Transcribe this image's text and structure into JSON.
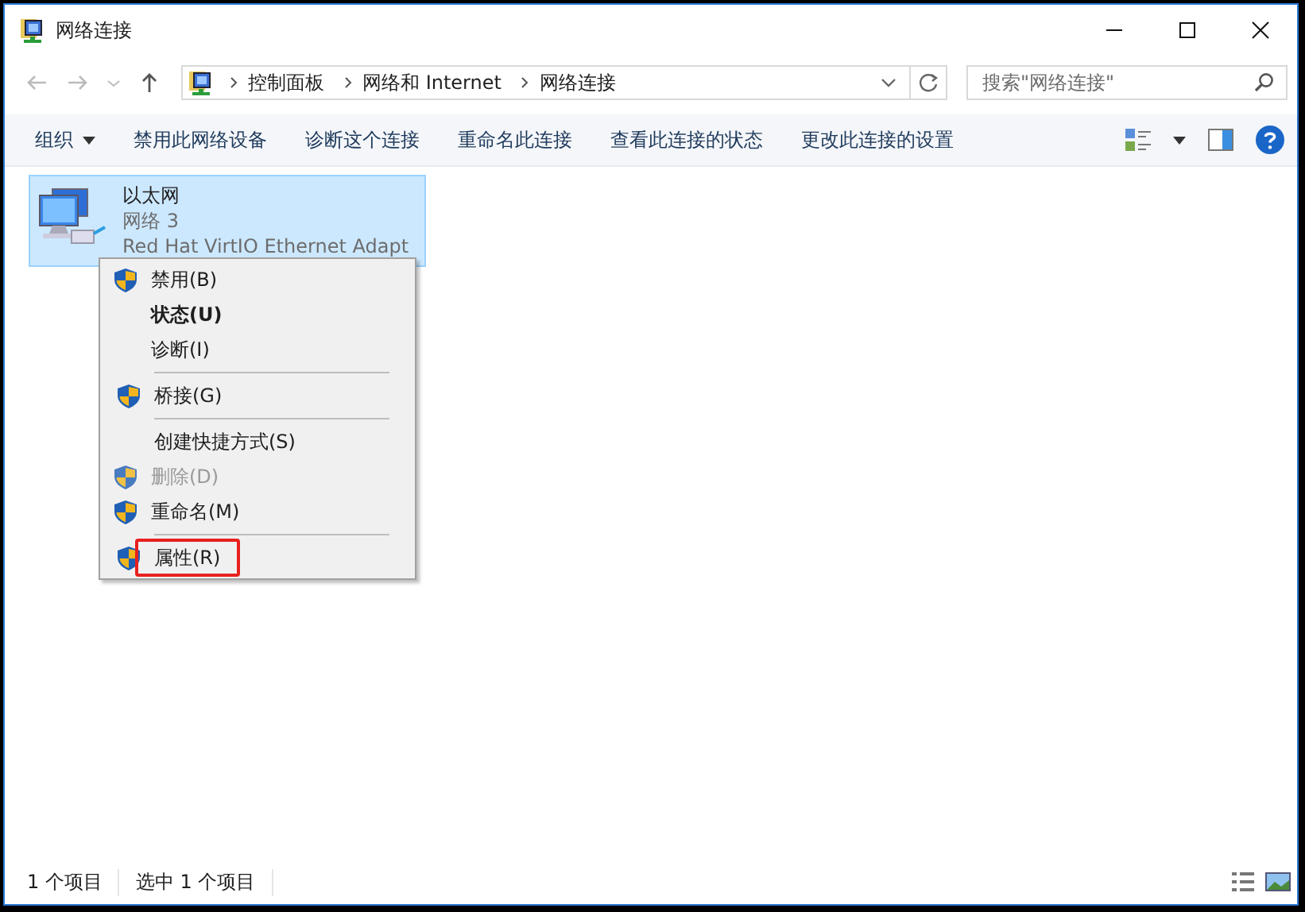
{
  "window": {
    "title": "网络连接"
  },
  "nav": {
    "crumbs": [
      "控制面板",
      "网络和 Internet",
      "网络连接"
    ],
    "search": {
      "placeholder": "搜索\"网络连接\""
    }
  },
  "toolbar": {
    "items": [
      {
        "label": "组织",
        "dropdown": true
      },
      {
        "label": "禁用此网络设备",
        "dropdown": false
      },
      {
        "label": "诊断这个连接",
        "dropdown": false
      },
      {
        "label": "重命名此连接",
        "dropdown": false
      },
      {
        "label": "查看此连接的状态",
        "dropdown": false
      },
      {
        "label": "更改此连接的设置",
        "dropdown": false
      }
    ]
  },
  "connections": [
    {
      "title": "以太网",
      "network": "网络  3",
      "adapter": "Red Hat VirtIO Ethernet Adapt",
      "selected": true
    }
  ],
  "context_menu": {
    "items": [
      {
        "label": "禁用(B)",
        "shield": true,
        "bold": false,
        "disabled": false,
        "separator_before": false,
        "highlighted": false
      },
      {
        "label": "状态(U)",
        "shield": false,
        "bold": true,
        "disabled": false,
        "separator_before": false,
        "highlighted": false
      },
      {
        "label": "诊断(I)",
        "shield": false,
        "bold": false,
        "disabled": false,
        "separator_before": false,
        "highlighted": false
      },
      {
        "label": "桥接(G)",
        "shield": true,
        "bold": false,
        "disabled": false,
        "separator_before": true,
        "highlighted": false
      },
      {
        "label": "创建快捷方式(S)",
        "shield": false,
        "bold": false,
        "disabled": false,
        "separator_before": true,
        "highlighted": false
      },
      {
        "label": "删除(D)",
        "shield": true,
        "bold": false,
        "disabled": true,
        "separator_before": false,
        "highlighted": false
      },
      {
        "label": "重命名(M)",
        "shield": true,
        "bold": false,
        "disabled": false,
        "separator_before": false,
        "highlighted": false
      },
      {
        "label": "属性(R)",
        "shield": true,
        "bold": false,
        "disabled": false,
        "separator_before": true,
        "highlighted": true
      }
    ]
  },
  "status_bar": [
    "1 个项目",
    "选中 1 个项目"
  ]
}
